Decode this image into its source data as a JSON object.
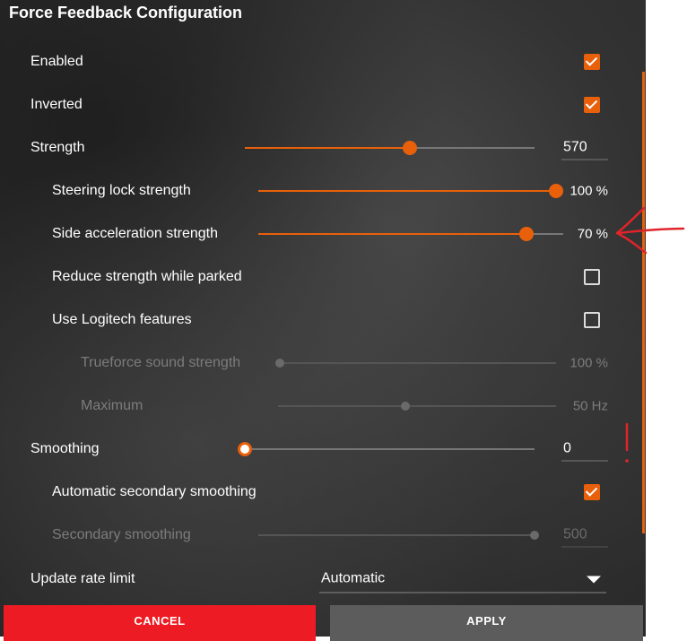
{
  "dialog": {
    "title": "Force Feedback Configuration",
    "settings": [
      {
        "label": "Enabled",
        "control": "checkbox",
        "checked": true
      },
      {
        "label": "Inverted",
        "control": "checkbox",
        "checked": true
      },
      {
        "label": "Strength",
        "control": "slider",
        "fraction": 0.57,
        "value": "570"
      },
      {
        "label": "Steering lock strength",
        "control": "slider",
        "fraction": 1.0,
        "value": "100 %"
      },
      {
        "label": "Side acceleration strength",
        "control": "slider",
        "fraction": 0.7,
        "value": "70 %"
      },
      {
        "label": "Reduce strength while parked",
        "control": "checkbox",
        "checked": false
      },
      {
        "label": "Use Logitech features",
        "control": "checkbox",
        "checked": false
      },
      {
        "label": "Trueforce sound strength",
        "control": "slider",
        "disabled": true,
        "value": "100 %"
      },
      {
        "label": "Maximum",
        "control": "slider",
        "disabled": true,
        "value": "50 Hz"
      },
      {
        "label": "Smoothing",
        "control": "slider",
        "fraction": 0.0,
        "value": "0"
      },
      {
        "label": "Automatic secondary smoothing",
        "control": "checkbox",
        "checked": true
      },
      {
        "label": "Secondary smoothing",
        "control": "slider",
        "disabled": true,
        "value": "500"
      },
      {
        "label": "Update rate limit",
        "control": "dropdown",
        "value": "Automatic"
      }
    ],
    "buttons": {
      "cancel": "CANCEL",
      "apply": "APPLY"
    }
  },
  "colors": {
    "accent": "#e8600a",
    "cancel": "#ed1c24",
    "apply": "#5c5c5c",
    "annotation": "#e0242a"
  },
  "icons": {
    "checkbox_checked": "checkmark-icon",
    "dropdown": "caret-down-icon",
    "annotation": "arrow-annotation-icon"
  }
}
